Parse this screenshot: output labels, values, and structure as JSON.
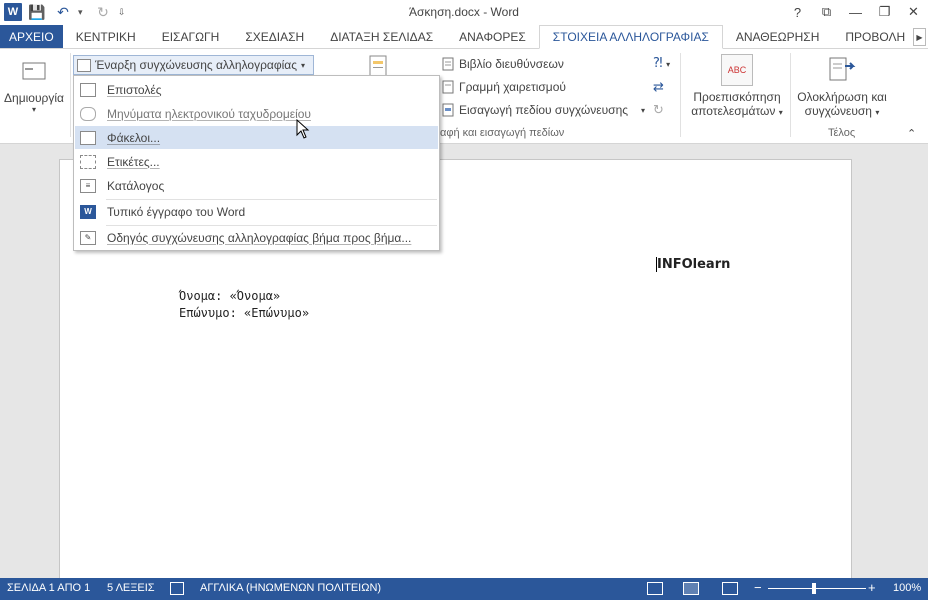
{
  "window": {
    "title": "Άσκηση.docx - Word",
    "controls": [
      "?",
      "⧉",
      "—",
      "❐",
      "✕"
    ]
  },
  "qat": {
    "word_logo": "W",
    "save": "💾",
    "undo": "↶",
    "undo_arrow": "▾",
    "redo": "↻",
    "customize": "⇩"
  },
  "tabs": [
    {
      "label": "ΑΡΧΕΙΟ",
      "type": "file"
    },
    {
      "label": "ΚΕΝΤΡΙΚΗ"
    },
    {
      "label": "ΕΙΣΑΓΩΓΗ"
    },
    {
      "label": "ΣΧΕΔΙΑΣΗ"
    },
    {
      "label": "ΔΙΑΤΑΞΗ ΣΕΛΙΔΑΣ"
    },
    {
      "label": "ΑΝΑΦΟΡΕΣ"
    },
    {
      "label": "ΣΤΟΙΧΕΙΑ ΑΛΛΗΛΟΓΡΑΦΙΑΣ",
      "type": "active"
    },
    {
      "label": "ΑΝΑΘΕΩΡΗΣΗ"
    },
    {
      "label": "ΠΡΟΒΟΛΗ"
    }
  ],
  "ribbon": {
    "create_label": "Δημιουργία",
    "start_merge_label": "Έναρξη συγχώνευσης αλληλογραφίας",
    "address_block": "Βιβλίο διευθύνσεων",
    "greeting_line": "Γραμμή χαιρετισμού",
    "insert_merge_field": "Εισαγωγή πεδίου συγχώνευσης",
    "write_insert_group": "αφή και εισαγωγή πεδίων",
    "preview_line1": "Προεπισκόπηση",
    "preview_line2": "αποτελεσμάτων",
    "preview_icon_text": "ABC",
    "finish_line1": "Ολοκλήρωση και",
    "finish_line2": "συγχώνευση",
    "finish_group": "Τέλος"
  },
  "dropdown": {
    "items": [
      {
        "label": "Επιστολές",
        "icon": "letter-icon",
        "state": "normal"
      },
      {
        "label": "Μηνύματα ηλεκτρονικού ταχυδρομείου",
        "icon": "email-icon",
        "state": "disabled"
      },
      {
        "label": "Φάκελοι...",
        "icon": "envelope-icon",
        "state": "hover"
      },
      {
        "label": "Ετικέτες...",
        "icon": "labels-icon",
        "state": "normal"
      },
      {
        "label": "Κατάλογος",
        "icon": "directory-icon",
        "state": "normal"
      },
      {
        "label": "Τυπικό έγγραφο του Word",
        "icon": "word-doc-icon",
        "state": "normal"
      },
      {
        "label": "Οδηγός συγχώνευσης αλληλογραφίας βήμα προς βήμα...",
        "icon": "wizard-icon",
        "state": "normal"
      }
    ]
  },
  "document": {
    "company": "INFOlearn",
    "line1": "Όνομα: «Όνομα»",
    "line2": "Επώνυμο: «Επώνυμο»"
  },
  "status": {
    "page": "ΣΕΛΙΔΑ 1 ΑΠΟ 1",
    "words": "5 ΛΕΞΕΙΣ",
    "language": "ΑΓΓΛΙΚΑ (ΗΝΩΜΕΝΩΝ ΠΟΛΙΤΕΙΩΝ)",
    "zoom": "100%",
    "zoom_minus": "−",
    "zoom_plus": "+"
  }
}
